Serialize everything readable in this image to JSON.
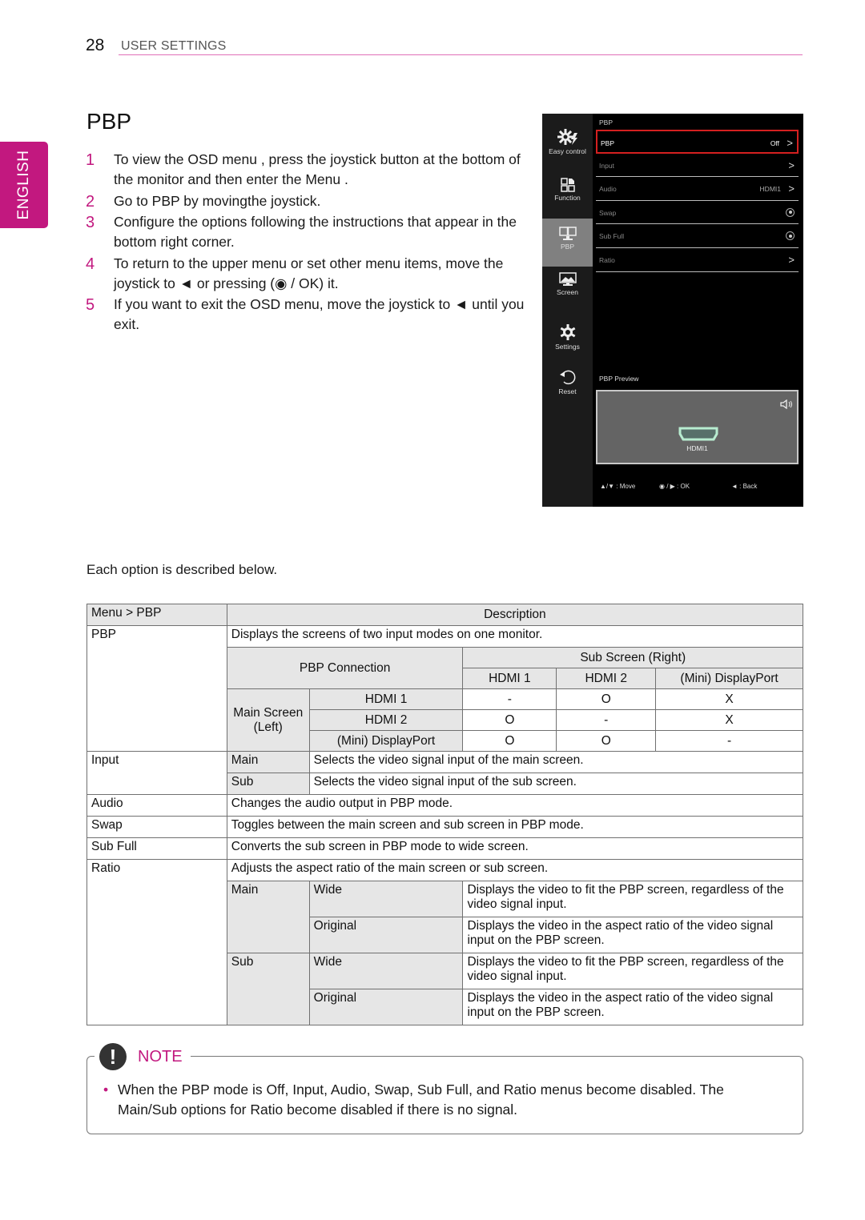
{
  "header": {
    "page_number": "28",
    "section": "USER SETTINGS",
    "accent_color": "#c2187f"
  },
  "language_tab": "ENGLISH",
  "title": "PBP",
  "steps": [
    {
      "num": "1",
      "text": "To view the OSD menu , press the joystick button    at the bottom of the monitor and then enter the Menu ."
    },
    {
      "num": "2",
      "text": "Go to PBP by movingthe joystick."
    },
    {
      "num": "3",
      "text": "Configure the options following the instructions that appear in the bottom right corner."
    },
    {
      "num": "4",
      "text": "To return to the upper menu or set other menu items, move the joystick to ◄ or pressing (◉ / OK) it."
    },
    {
      "num": "5",
      "text": "If you want to exit the OSD menu, move the joystick to ◄ until you exit."
    }
  ],
  "osd": {
    "breadcrumb": "PBP",
    "sidebar": [
      {
        "label": "Easy control",
        "icon": "easy-control-icon"
      },
      {
        "label": "Function",
        "icon": "function-icon"
      },
      {
        "label": "PBP",
        "icon": "pbp-icon",
        "active": true
      },
      {
        "label": "Screen",
        "icon": "screen-icon"
      },
      {
        "label": "Settings",
        "icon": "settings-gear-icon"
      },
      {
        "label": "Reset",
        "icon": "reset-icon"
      }
    ],
    "items": [
      {
        "label": "PBP",
        "value": "Off",
        "control": "chevron",
        "selected": true
      },
      {
        "label": "Input",
        "value": "",
        "control": "chevron"
      },
      {
        "label": "Audio",
        "value": "HDMI1",
        "control": "chevron"
      },
      {
        "label": "Swap",
        "value": "",
        "control": "radio"
      },
      {
        "label": "Sub Full",
        "value": "",
        "control": "radio"
      },
      {
        "label": "Ratio",
        "value": "",
        "control": "chevron"
      }
    ],
    "chevron": ">",
    "preview_label": "PBP Preview",
    "preview_input": "HDMI1",
    "help": {
      "move": "▲/▼ : Move",
      "ok": "◉ / ▶ : OK",
      "back": "◄ : Back"
    },
    "highlight_color": "#d42020"
  },
  "each_option": "Each option is described below.",
  "table": {
    "header": {
      "menu": "Menu > PBP",
      "description": "Description"
    },
    "pbp": {
      "label": "PBP",
      "desc": "Displays the screens of two input modes on one monitor.",
      "connection_label": "PBP Connection",
      "sub_screen_label": "Sub Screen (Right)",
      "main_screen_label": "Main Screen (Left)",
      "columns": [
        "HDMI 1",
        "HDMI 2",
        "(Mini) DisplayPort"
      ],
      "rows": [
        {
          "input": "HDMI 1",
          "values": [
            "-",
            "O",
            "X"
          ]
        },
        {
          "input": "HDMI 2",
          "values": [
            "O",
            "-",
            "X"
          ]
        },
        {
          "input": "(Mini) DisplayPort",
          "values": [
            "O",
            "O",
            "-"
          ]
        }
      ]
    },
    "input": {
      "label": "Input",
      "rows": [
        {
          "name": "Main",
          "desc": "Selects the video signal input of the main screen."
        },
        {
          "name": "Sub",
          "desc": "Selects the video signal input of the sub screen."
        }
      ]
    },
    "audio": {
      "label": "Audio",
      "desc": "Changes the audio output in PBP mode."
    },
    "swap": {
      "label": "Swap",
      "desc": "Toggles between the main screen and sub screen in PBP mode."
    },
    "sub_full": {
      "label": "Sub Full",
      "desc": "Converts the sub screen in PBP mode to wide screen."
    },
    "ratio": {
      "label": "Ratio",
      "desc": "Adjusts the aspect ratio of the main screen or sub screen.",
      "main_label": "Main",
      "sub_label": "Sub",
      "wide": "Wide",
      "original": "Original",
      "wide_desc": "Displays the video to fit the PBP screen, regardless of the video signal input.",
      "original_desc": "Displays the video in the aspect ratio of the video signal input on the PBP screen."
    }
  },
  "note": {
    "label": "NOTE",
    "icon": "!",
    "bullet": "•",
    "text": "When the PBP mode is Off, Input, Audio, Swap, Sub Full, and Ratio menus become disabled. The Main/Sub options for Ratio become disabled if there is no signal."
  }
}
